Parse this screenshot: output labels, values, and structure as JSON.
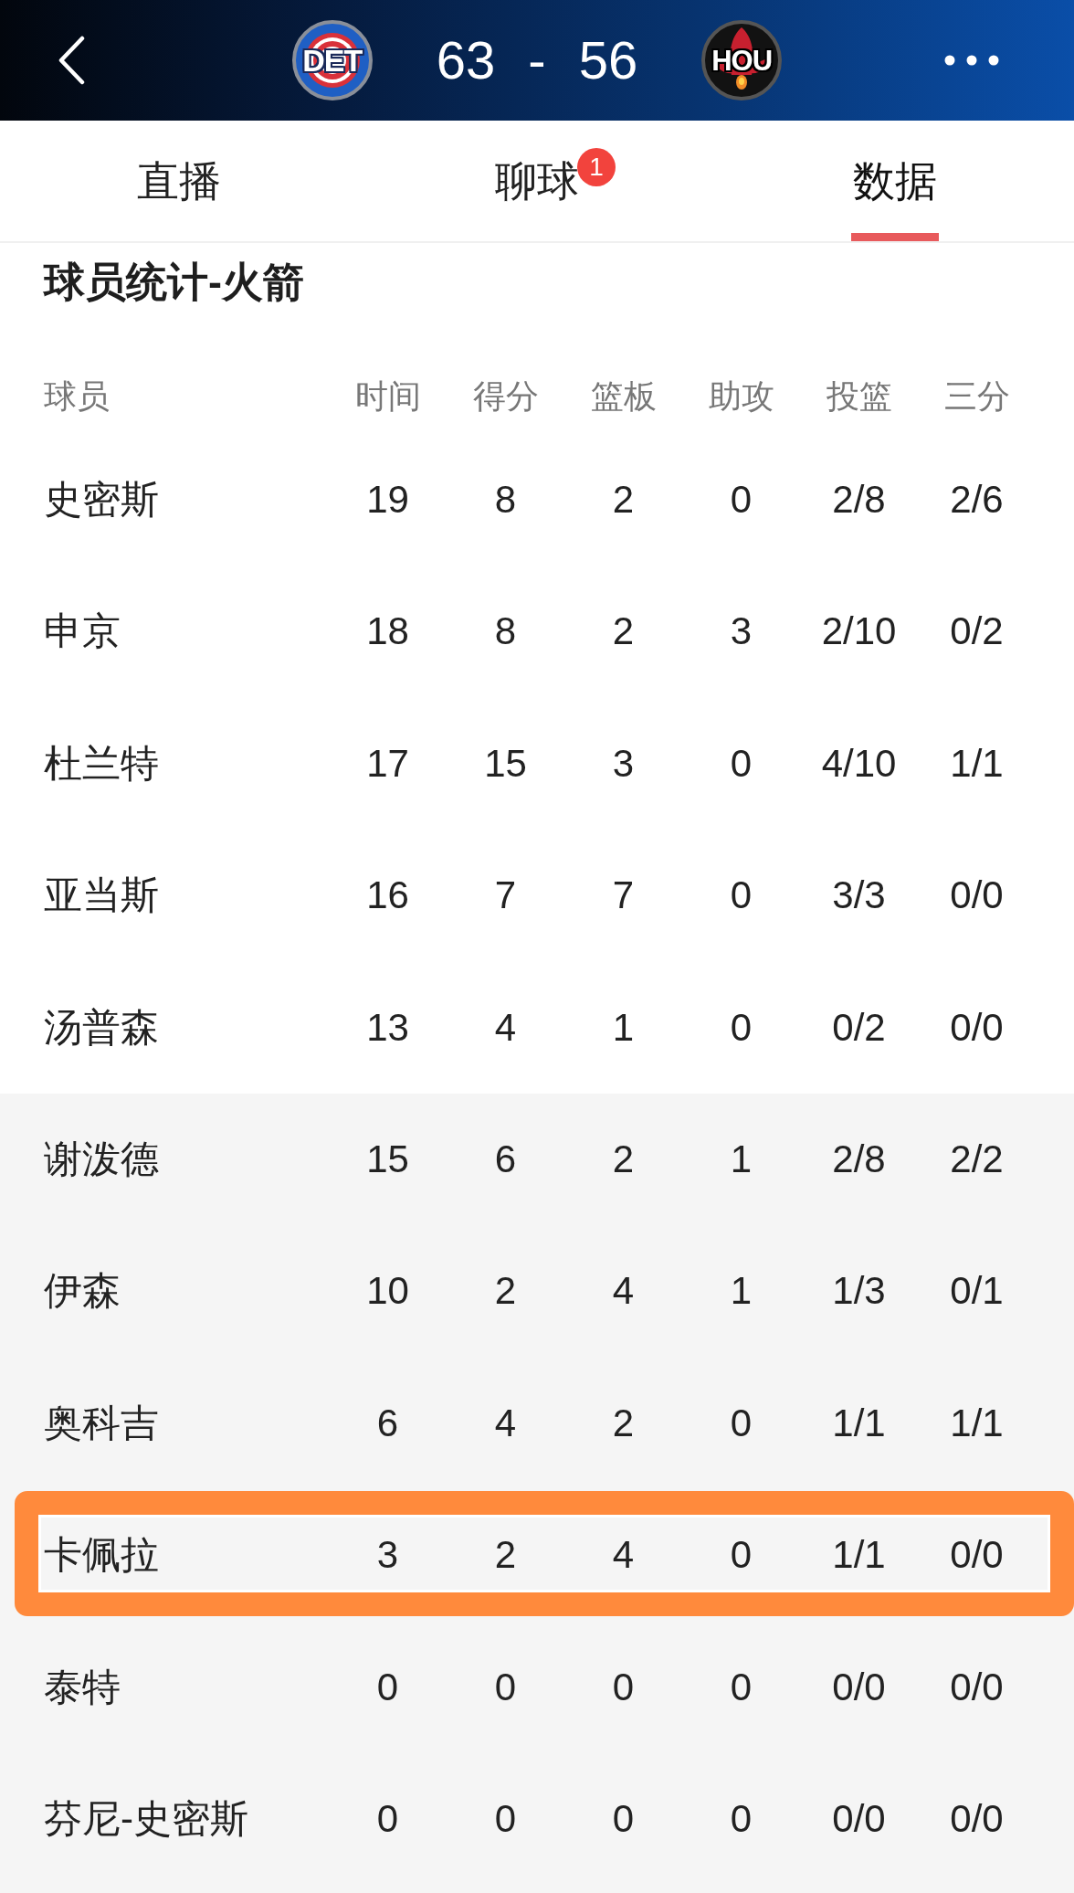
{
  "header": {
    "home": {
      "logo_text": "DET",
      "score": "63"
    },
    "separator": "-",
    "away": {
      "logo_text": "HOU",
      "score": "56"
    }
  },
  "tabs": [
    {
      "label": "直播",
      "selected": false
    },
    {
      "label": "聊球",
      "selected": false,
      "badge": "1"
    },
    {
      "label": "数据",
      "selected": true
    }
  ],
  "section": {
    "title": "球员统计-火箭"
  },
  "table": {
    "columns": [
      "球员",
      "时间",
      "得分",
      "篮板",
      "助攻",
      "投篮",
      "三分"
    ],
    "starters": [
      {
        "name": "史密斯",
        "stats": [
          "19",
          "8",
          "2",
          "0",
          "2/8",
          "2/6"
        ],
        "highlighted": false
      },
      {
        "name": "申京",
        "stats": [
          "18",
          "8",
          "2",
          "3",
          "2/10",
          "0/2"
        ],
        "highlighted": false
      },
      {
        "name": "杜兰特",
        "stats": [
          "17",
          "15",
          "3",
          "0",
          "4/10",
          "1/1"
        ],
        "highlighted": false
      },
      {
        "name": "亚当斯",
        "stats": [
          "16",
          "7",
          "7",
          "0",
          "3/3",
          "0/0"
        ],
        "highlighted": false
      },
      {
        "name": "汤普森",
        "stats": [
          "13",
          "4",
          "1",
          "0",
          "0/2",
          "0/0"
        ],
        "highlighted": false
      }
    ],
    "bench": [
      {
        "name": "谢泼德",
        "stats": [
          "15",
          "6",
          "2",
          "1",
          "2/8",
          "2/2"
        ],
        "highlighted": false
      },
      {
        "name": "伊森",
        "stats": [
          "10",
          "2",
          "4",
          "1",
          "1/3",
          "0/1"
        ],
        "highlighted": false
      },
      {
        "name": "奥科吉",
        "stats": [
          "6",
          "4",
          "2",
          "0",
          "1/1",
          "1/1"
        ],
        "highlighted": false
      },
      {
        "name": "卡佩拉",
        "stats": [
          "3",
          "2",
          "4",
          "0",
          "1/1",
          "0/0"
        ],
        "highlighted": true
      },
      {
        "name": "泰特",
        "stats": [
          "0",
          "0",
          "0",
          "0",
          "0/0",
          "0/0"
        ],
        "highlighted": false
      },
      {
        "name": "芬尼-史密斯",
        "stats": [
          "0",
          "0",
          "0",
          "0",
          "0/0",
          "0/0"
        ],
        "highlighted": false
      }
    ]
  }
}
